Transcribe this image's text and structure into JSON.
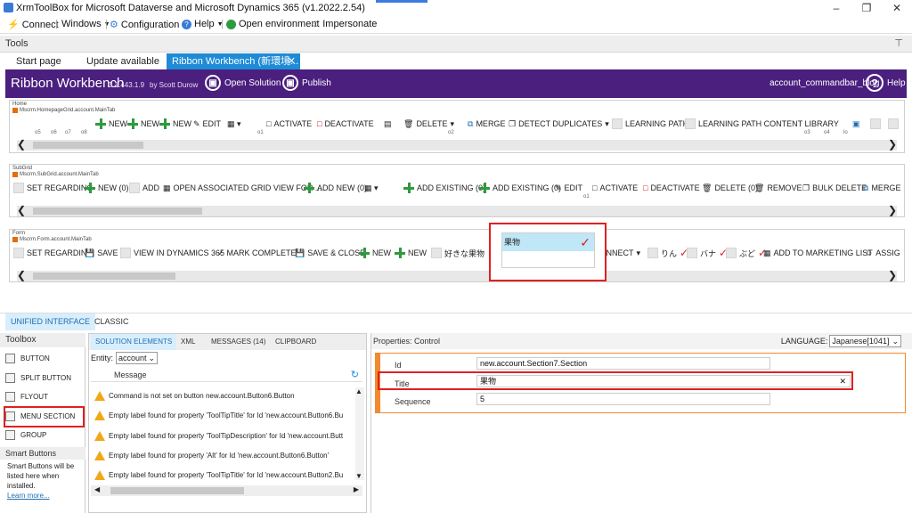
{
  "window": {
    "title": "XrmToolBox for Microsoft Dataverse and Microsoft Dynamics 365 (v1.2022.2.54)"
  },
  "main_toolbar": {
    "connect": "Connect",
    "windows": "Windows",
    "configuration": "Configuration",
    "help": "Help",
    "open_environment": "Open environment",
    "impersonate": "Impersonate"
  },
  "tools_strip": {
    "label": "Tools"
  },
  "doc_tabs": {
    "start": "Start page",
    "update": "Update available",
    "active": "Ribbon Workbench (新環境..."
  },
  "ribbon_header": {
    "brand": "Ribbon Workbench",
    "version": "3.1.443.1.9",
    "by": "by Scott Durow",
    "open_solution": "Open Solution",
    "publish": "Publish",
    "solution_name": "account_commandbar_blog",
    "help": "Help"
  },
  "home_panel": {
    "title": "Home",
    "subtitle": "Mscrm.HomepageGrid.account.MainTab",
    "cmds": [
      "NEW",
      "NEW",
      "NEW",
      "EDIT",
      "ACTIVATE",
      "DEACTIVATE",
      "DELETE",
      "MERGE",
      "DETECT DUPLICATES",
      "LEARNING PATH",
      "LEARNING PATH CONTENT LIBRARY"
    ],
    "markers": [
      "o5",
      "o6",
      "o7",
      "o8",
      "o1",
      "o2",
      "o3",
      "o4",
      "lo"
    ]
  },
  "subgrid_panel": {
    "title": "SubGrid",
    "subtitle": "Mscrm.SubGrid.account.MainTab",
    "cmds": [
      "SET REGARDING",
      "NEW (0)",
      "ADD",
      "OPEN ASSOCIATED GRID VIEW FOR ...",
      "ADD NEW (0)",
      "ADD EXISTING (0)",
      "ADD EXISTING (0)",
      "EDIT",
      "ACTIVATE",
      "DEACTIVATE",
      "DELETE (0)",
      "REMOVE",
      "BULK DELETE",
      "MERGE"
    ],
    "marker": "o1"
  },
  "form_panel": {
    "title": "Form",
    "subtitle": "Mscrm.Form.account.MainTab",
    "cmds": [
      "SET REGARDING",
      "SAVE",
      "VIEW IN DYNAMICS 365",
      "MARK COMPLETE",
      "SAVE & CLOSE",
      "NEW",
      "NEW",
      "好きな果物",
      "CONNECT",
      "りん",
      "バナ",
      "ぶど",
      "ADD TO MARKETING LIST",
      "ASSIG"
    ]
  },
  "popup": {
    "item": "果物"
  },
  "lower_tabs": {
    "unified": "UNIFIED INTERFACE",
    "classic": "CLASSIC"
  },
  "toolbox": {
    "header": "Toolbox",
    "items": [
      "BUTTON",
      "SPLIT BUTTON",
      "FLYOUT",
      "MENU SECTION",
      "GROUP"
    ],
    "smart_header": "Smart Buttons",
    "smart_desc": "Smart Buttons will be listed here when installed.",
    "learn_more": "Learn more..."
  },
  "solution_pane": {
    "tabs": [
      "SOLUTION ELEMENTS",
      "XML",
      "MESSAGES (14)",
      "CLIPBOARD"
    ],
    "entity_label": "Entity:",
    "entity_value": "account",
    "message_header": "Message",
    "messages": [
      "Command is not set on button new.account.Button6.Button",
      "Empty label found for property 'ToolTipTitle' for Id 'new.account.Button6.Bu",
      "Empty label found for property 'ToolTipDescription' for Id 'new.account.Butt",
      "Empty label found for property 'Alt' for Id 'new.account.Button6.Button'",
      "Empty label found for property 'ToolTipTitle' for Id 'new.account.Button2.Bu"
    ]
  },
  "properties": {
    "header": "Properties: Control",
    "language_label": "LANGUAGE:",
    "language_value": "Japanese[1041]",
    "id_label": "Id",
    "id_value": "new.account.Section7.Section",
    "title_label": "Title",
    "title_value": "果物",
    "sequence_label": "Sequence",
    "sequence_value": "5"
  },
  "colors": {
    "ribbon_header": "#4b1f7e",
    "accent": "#1e8bd6",
    "highlight": "#e02020",
    "active_tab_bg": "#d9eefc",
    "orange_marker": "#e46c0a"
  }
}
